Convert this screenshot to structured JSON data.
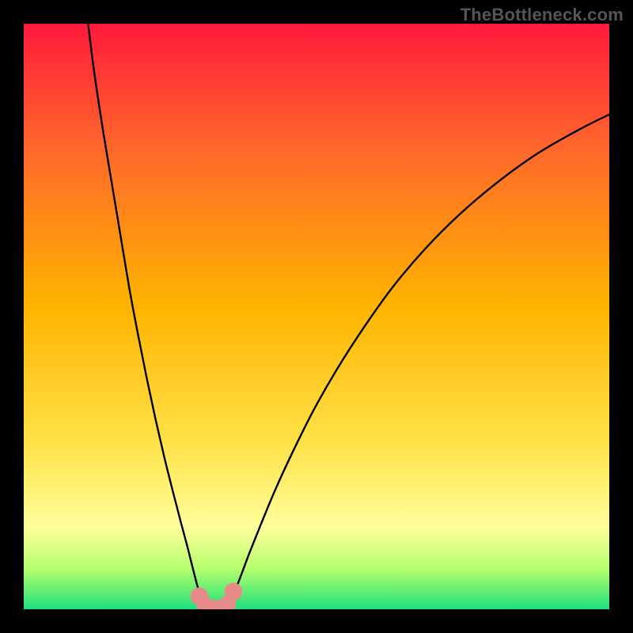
{
  "watermark": "TheBottleneck.com",
  "colors": {
    "page_bg": "#000000",
    "gradient_top": "#ff1a3c",
    "gradient_mid_upper": "#ff6a2a",
    "gradient_mid": "#ffb300",
    "gradient_mid_lower": "#ffe34a",
    "gradient_band": "#ffff9c",
    "gradient_green_light": "#b6ff6e",
    "gradient_green": "#1fe07a",
    "curve": "#000000",
    "dot_fill": "#e88a8a",
    "dot_stroke": "#c25b5b"
  },
  "chart_data": {
    "type": "line",
    "title": "",
    "xlabel": "",
    "ylabel": "",
    "xlim": [
      0,
      100
    ],
    "ylim": [
      0,
      100
    ],
    "series": [
      {
        "name": "left-arc",
        "x": [
          11.0,
          12.0,
          13.5,
          15.0,
          16.5,
          18.0,
          19.5,
          21.0,
          22.5,
          24.0,
          25.5,
          26.8,
          28.0,
          29.0,
          29.8,
          30.5,
          31.1,
          31.8
        ],
        "y": [
          100.0,
          92.0,
          82.0,
          73.0,
          64.0,
          55.0,
          47.0,
          39.5,
          32.5,
          26.0,
          20.0,
          15.0,
          10.5,
          6.5,
          3.5,
          1.6,
          0.5,
          0.0
        ]
      },
      {
        "name": "right-arc",
        "x": [
          34.6,
          35.0,
          35.8,
          37.0,
          38.5,
          40.5,
          43.0,
          46.0,
          49.5,
          53.5,
          58.0,
          63.0,
          68.5,
          74.5,
          81.0,
          88.0,
          95.0,
          100.0
        ],
        "y": [
          0.0,
          0.8,
          2.5,
          5.5,
          9.5,
          14.5,
          20.5,
          27.0,
          34.0,
          41.0,
          48.0,
          55.0,
          61.5,
          67.5,
          73.0,
          78.0,
          82.0,
          84.5
        ]
      },
      {
        "name": "valley",
        "x": [
          31.8,
          32.5,
          33.3,
          34.0,
          34.6
        ],
        "y": [
          0.0,
          -0.2,
          -0.3,
          -0.2,
          0.0
        ]
      }
    ],
    "dots": [
      {
        "x": 30.0,
        "y": 2.2,
        "r": 1.1
      },
      {
        "x": 31.0,
        "y": 0.7,
        "r": 1.0
      },
      {
        "x": 32.5,
        "y": 0.0,
        "r": 1.2
      },
      {
        "x": 33.8,
        "y": 0.1,
        "r": 1.1
      },
      {
        "x": 34.8,
        "y": 0.9,
        "r": 1.0
      },
      {
        "x": 35.8,
        "y": 3.0,
        "r": 1.1
      }
    ]
  }
}
